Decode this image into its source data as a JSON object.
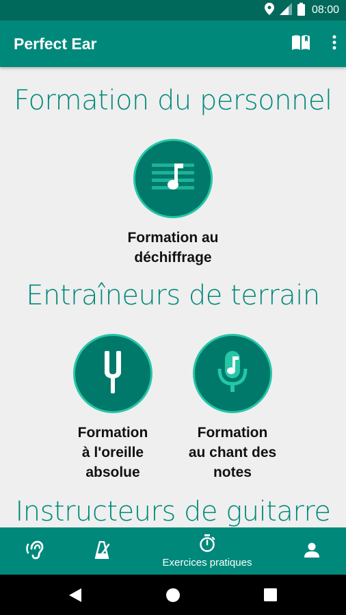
{
  "status_bar": {
    "time": "08:00",
    "icons": [
      "location-icon",
      "signal-icon",
      "battery-icon"
    ]
  },
  "app_bar": {
    "title": "Perfect Ear",
    "actions": [
      "book-icon",
      "more-vert-icon"
    ]
  },
  "sections": [
    {
      "title": "Formation du personnel",
      "items": [
        {
          "label": "Formation au\ndéchiffrage",
          "icon": "sheet-music-icon"
        }
      ]
    },
    {
      "title": "Entraîneurs de terrain",
      "items": [
        {
          "label": "Formation\nà l'oreille\nabsolue",
          "icon": "tuning-fork-icon"
        },
        {
          "label": "Formation\nau chant des\nnotes",
          "icon": "microphone-note-icon"
        }
      ]
    },
    {
      "title": "Instructeurs de guitarre",
      "items": []
    }
  ],
  "bottom_nav": {
    "items": [
      {
        "icon": "ear-icon",
        "label": ""
      },
      {
        "icon": "metronome-icon",
        "label": ""
      },
      {
        "icon": "stopwatch-icon",
        "label": "Exercices pratiques"
      },
      {
        "icon": "person-icon",
        "label": ""
      }
    ]
  },
  "colors": {
    "primary": "#00897b",
    "primary_dark": "#00695c",
    "circle": "#00796b",
    "circle_border": "#26c6a6",
    "background": "#efefef"
  }
}
